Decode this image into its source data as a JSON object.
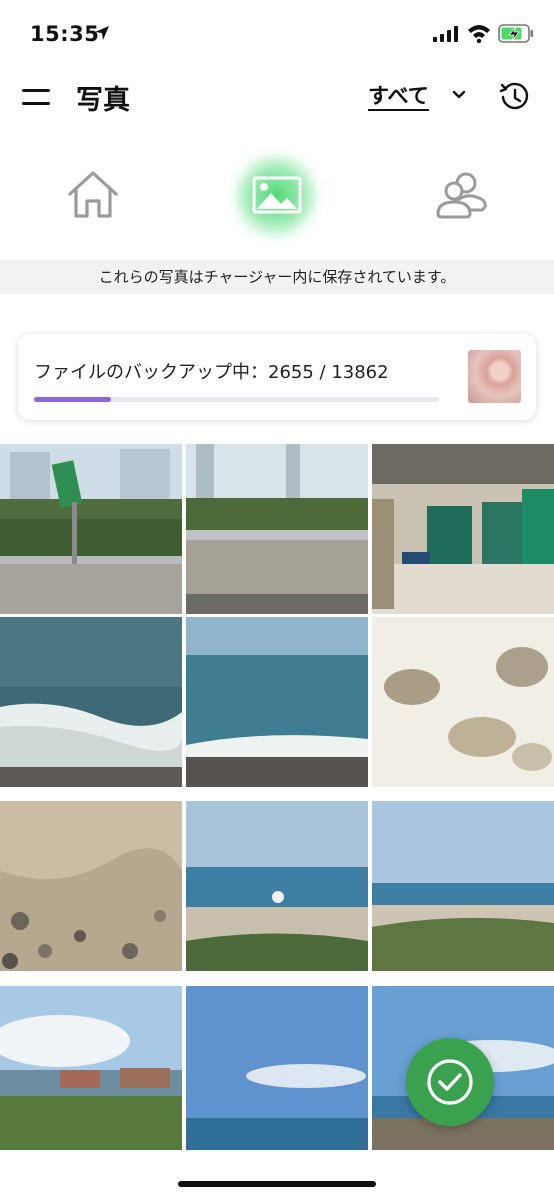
{
  "status_bar": {
    "time": "15:35",
    "icons": [
      "location-arrow-icon",
      "signal-icon",
      "wifi-icon",
      "battery-charging-icon"
    ]
  },
  "header": {
    "title": "写真",
    "filter_label": "すべて",
    "icons": [
      "menu-icon",
      "chevron-down-icon",
      "history-icon"
    ]
  },
  "tabs": [
    {
      "name": "home",
      "icon": "home-icon",
      "active": false
    },
    {
      "name": "photos",
      "icon": "image-icon",
      "active": true
    },
    {
      "name": "people",
      "icon": "people-icon",
      "active": false
    }
  ],
  "info_strip": {
    "text": "これらの写真はチャージャー内に保存されています。"
  },
  "backup": {
    "text": "ファイルのバックアップ中：2655 / 13862",
    "progress_fraction": 0.19
  },
  "colors": {
    "accent": "#8a66d6",
    "active_tab_glow": "#46d76e",
    "fab": "#3aa24f"
  },
  "fab": {
    "icon": "checkmark-circle-icon"
  }
}
